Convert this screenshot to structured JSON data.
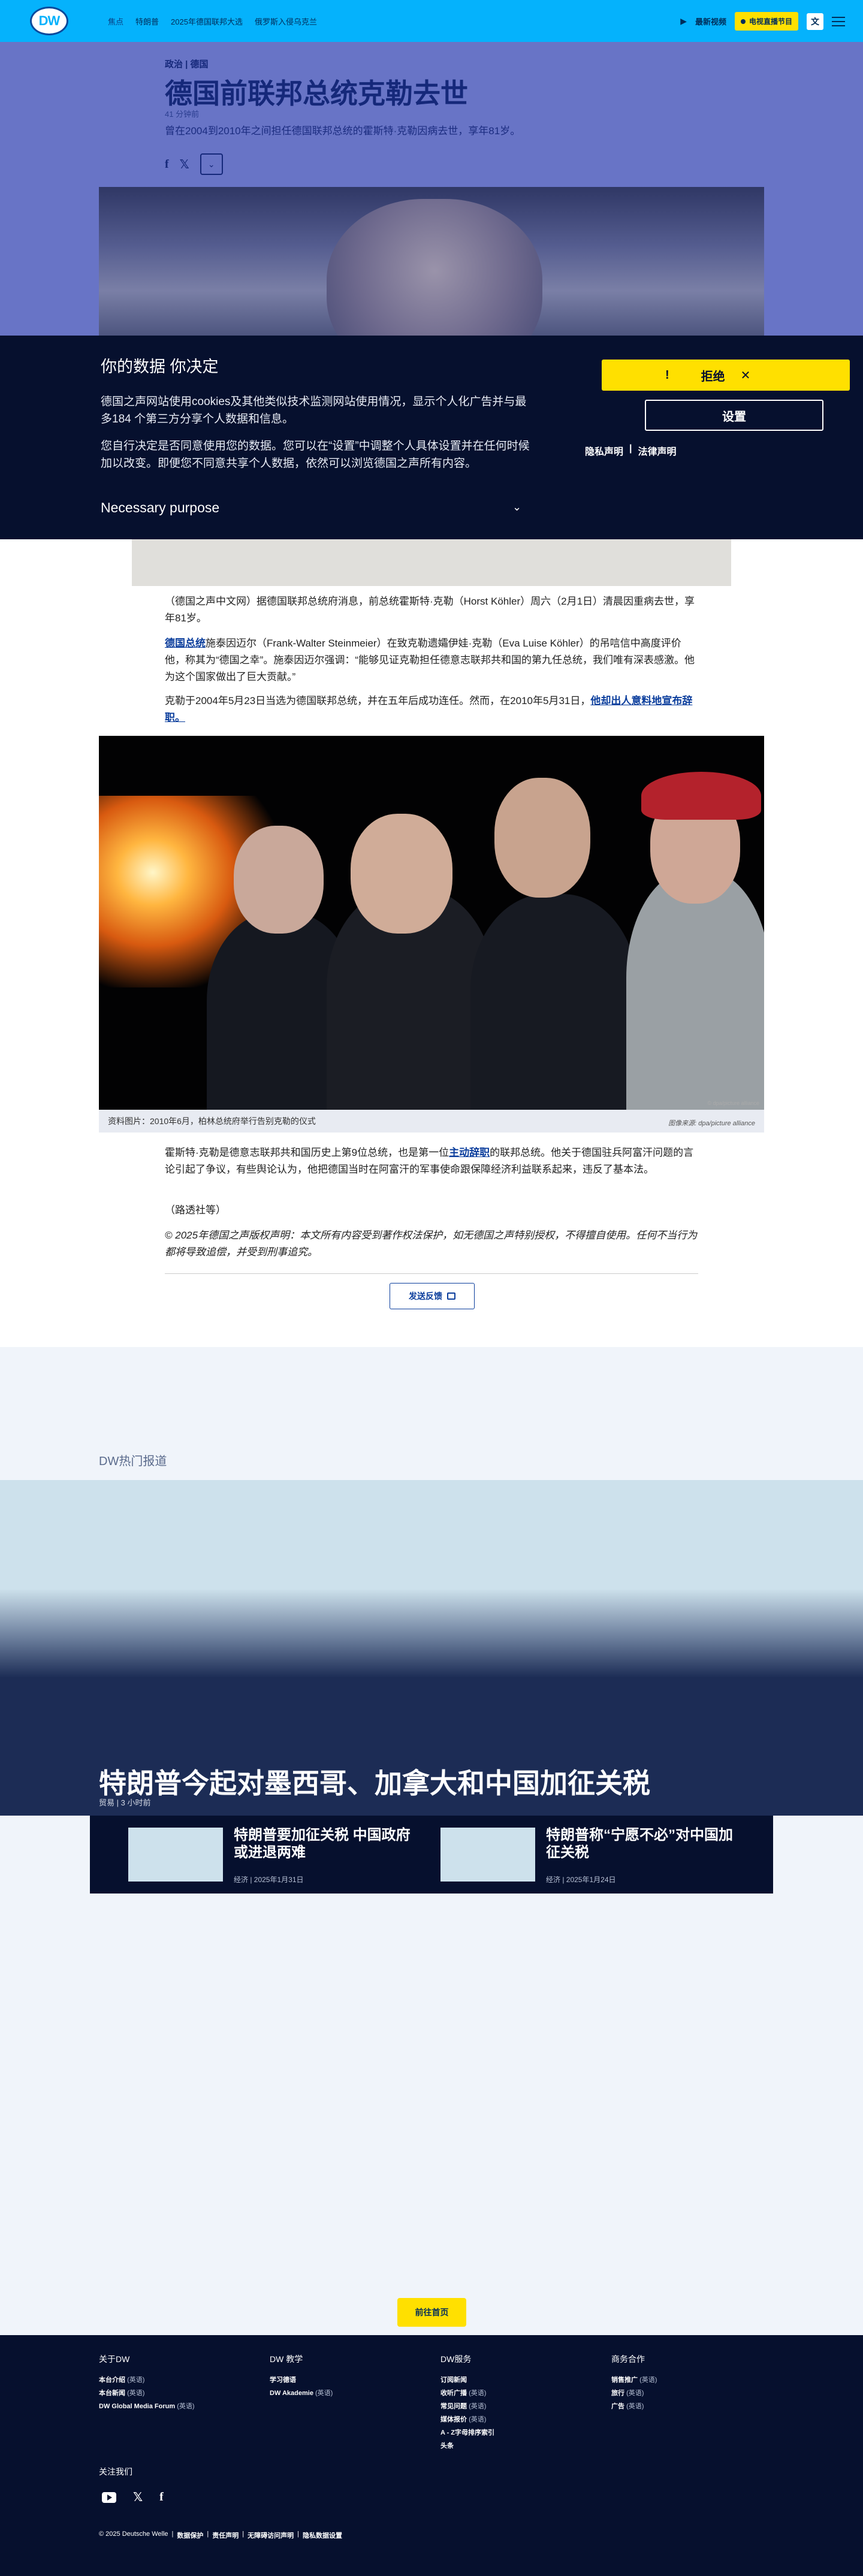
{
  "header": {
    "logo_text": "DW",
    "nav": [
      "焦点",
      "特朗普",
      "2025年德国联邦大选",
      "俄罗斯入侵乌克兰"
    ],
    "video_label": "最新视频",
    "live_label": "电视直播节目",
    "lang_label": "文"
  },
  "article": {
    "breadcrumb": "政治 | 德国",
    "title": "德国前联邦总统克勒去世",
    "date": "41 分钟前",
    "teaser": "曾在2004到2010年之间担任德国联邦总统的霍斯特·克勒因病去世，享年81岁。",
    "share_icons": [
      "facebook-icon",
      "x-icon",
      "more-icon"
    ],
    "paragraphs": [
      "（德国之声中文网）据德国联邦总统府消息，前总统霍斯特·克勒（Horst Köhler）周六（2月1日）清晨因重病去世，享年81岁。",
      "施泰因迈尔（Frank-Walter Steinmeier）在致克勒遗孀伊娃·克勒（Eva Luise Köhler）的吊唁信中高度评价他，称其为“德国之幸”。施泰因迈尔强调：“能够见证克勒担任德意志联邦共和国的第九任总统，我们唯有深表感激。他为这个国家做出了巨大贡献。”",
      "克勒于2004年5月23日当选为德国联邦总统，并在五年后成功连任。然而，在2010年5月31日，"
    ],
    "para2_link": "德国总统",
    "para3_link": "他却出人意料地宣布辞职。",
    "caption": "资料图片：2010年6月，柏林总统府举行告别克勒的仪式",
    "credit": "图像来源: dpa/picture alliance",
    "image_watermark": "© dpa/picture alliance",
    "para4_a": "霍斯特·克勒是德意志联邦共和国历史上第9位总统，也是第一位",
    "para4_link": "主动辞职",
    "para4_b": "的联邦总统。他关于德国驻兵阿富汗问题的言论引起了争议，有些舆论认为，他把德国当时在阿富汗的军事使命跟保障经济利益联系起来，违反了基本法。",
    "source": "（路透社等）",
    "copyright": "© 2025年德国之声版权声明：本文所有内容受到著作权法保护，如无德国之声特别授权，不得擅自使用。任何不当行为都将导致追偿，并受到刑事追究。",
    "feedback_label": "发送反馈"
  },
  "cookie": {
    "title": "你的数据 你决定",
    "p1": "德国之声网站使用cookies及其他类似技术监测网站使用情况，显示个人化广告并与最多184 个第三方分享个人数据和信息。",
    "p2": "您自行决定是否同意使用您的数据。您可以在“设置”中调整个人具体设置并在任何时候加以改变。即便您不同意共享个人数据，依然可以浏览德国之声所有内容。",
    "purpose": "Necessary purpose",
    "reject_label": "拒绝",
    "settings_label": "设置",
    "privacy_link": "隐私声明",
    "legal_link": "法律声明",
    "divider": "|"
  },
  "hot": {
    "section_title": "DW热门报道",
    "headline": "特朗普今起对墨西哥、加拿大和中国加征关税",
    "meta": "贸易 | 3 小时前",
    "cards": [
      {
        "title": "特朗普要加征关税 中国政府或进退两难",
        "meta": "经济 | 2025年1月31日"
      },
      {
        "title": "特朗普称“宁愿不必”对中国加征关税",
        "meta": "经济 | 2025年1月24日"
      }
    ]
  },
  "home_button": "前往首页",
  "footer": {
    "cols": [
      {
        "title": "关于DW",
        "items": [
          [
            "本台介绍",
            "(英语)"
          ],
          [
            "本台新闻",
            "(英语)"
          ],
          [
            "DW Global Media Forum",
            "(英语)"
          ]
        ]
      },
      {
        "title": "DW 教学",
        "items": [
          [
            "学习德语",
            ""
          ],
          [
            "DW Akademie",
            "(英语)"
          ]
        ]
      },
      {
        "title": "DW服务",
        "items": [
          [
            "订阅新闻",
            ""
          ],
          [
            "收听广播",
            "(英语)"
          ],
          [
            "常见问题",
            "(英语)"
          ],
          [
            "媒体报价",
            "(英语)"
          ],
          [
            "A - Z字母排序索引",
            ""
          ],
          [
            "头条",
            ""
          ]
        ]
      },
      {
        "title": "商务合作",
        "items": [
          [
            "销售推广",
            "(英语)"
          ],
          [
            "旅行",
            "(英语)"
          ],
          [
            "广告",
            "(英语)"
          ]
        ]
      }
    ],
    "follow_label": "关注我们",
    "social_icons": [
      "youtube-icon",
      "x-icon",
      "facebook-icon"
    ],
    "links": [
      "© 2025 Deutsche Welle",
      "数据保护",
      "责任声明",
      "无障碍访问声明",
      "隐私数据设置"
    ],
    "sep": "|"
  },
  "colors": {
    "brand_blue": "#05b2fc",
    "navy": "#06102e",
    "yellow": "#ffe000",
    "link": "#0a3d9c"
  }
}
